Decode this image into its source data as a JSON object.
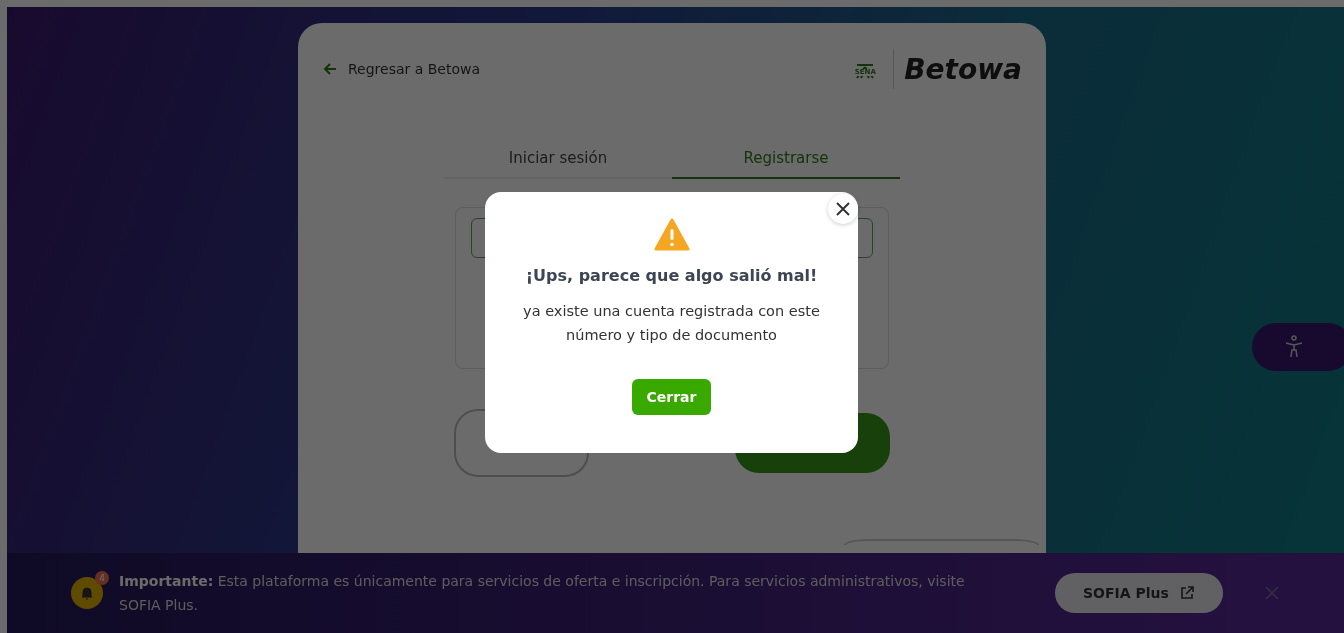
{
  "header": {
    "back_link": "Regresar a Betowa",
    "logo_mark": "SENA",
    "logo_text": "Betowa"
  },
  "tabs": [
    {
      "label": "Iniciar sesión",
      "selected": false
    },
    {
      "label": "Registrarse",
      "selected": true
    }
  ],
  "dialog": {
    "title": "¡Ups, parece que algo salió mal!",
    "message": "ya existe una cuenta registrada con este número y tipo de documento",
    "button": "Cerrar"
  },
  "banner": {
    "badge": "4",
    "text": "**Importante:** Esta plataforma es únicamente para servicios de oferta e inscripción. Para servicios administrativos, visite SOFIA Plus.",
    "button": "SOFIA Plus"
  }
}
